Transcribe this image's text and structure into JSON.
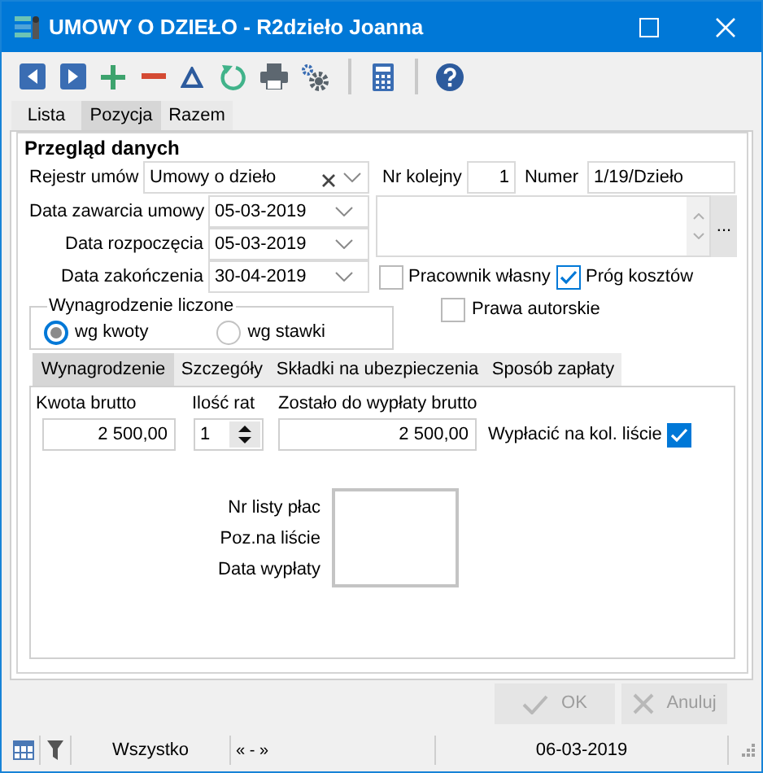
{
  "window": {
    "title": "UMOWY O DZIEŁO - R2dzieło Joanna"
  },
  "tabs": [
    {
      "label": "Lista",
      "selected": false
    },
    {
      "label": "Pozycja",
      "selected": true
    },
    {
      "label": "Razem",
      "selected": false
    }
  ],
  "overview": {
    "title": "Przegląd danych",
    "register": {
      "label": "Rejestr umów",
      "value": "Umowy o dzieło"
    },
    "sequence": {
      "label": "Nr kolejny",
      "value": "1"
    },
    "number": {
      "label": "Numer",
      "value": "1/19/Dzieło"
    },
    "dates": [
      {
        "label": "Data zawarcia umowy",
        "value": "05-03-2019"
      },
      {
        "label": "Data rozpoczęcia",
        "value": "05-03-2019"
      },
      {
        "label": "Data zakończenia",
        "value": "30-04-2019"
      }
    ],
    "notes_button": "...",
    "flags": [
      {
        "label": "Pracownik własny",
        "checked": false
      },
      {
        "label": "Próg kosztów",
        "checked": true
      },
      {
        "label": "Prawa autorskie",
        "checked": false
      }
    ],
    "pay_basis": {
      "title": "Wynagrodzenie liczone",
      "options": [
        {
          "label": "wg kwoty",
          "selected": true
        },
        {
          "label": "wg stawki",
          "selected": false
        }
      ]
    },
    "detail_tabs": [
      {
        "label": "Wynagrodzenie",
        "selected": true
      },
      {
        "label": "Szczegóły",
        "selected": false
      },
      {
        "label": "Składki na ubezpieczenia",
        "selected": false
      },
      {
        "label": "Sposób zapłaty",
        "selected": false
      }
    ],
    "gross": {
      "label": "Kwota brutto",
      "value": "2 500,00"
    },
    "installments": {
      "label": "Ilość rat",
      "value": "1"
    },
    "remaining": {
      "label": "Zostało do wypłaty brutto",
      "value": "2 500,00"
    },
    "pay_on_next_list": {
      "label": "Wypłacić na kol. liście",
      "checked": true
    },
    "payroll_labels": [
      "Nr listy płac",
      "Poz.na liście",
      "Data wypłaty"
    ]
  },
  "buttons": [
    {
      "label": "OK",
      "kind": "ok",
      "disabled": true
    },
    {
      "label": "Anuluj",
      "kind": "cancel",
      "disabled": true
    }
  ],
  "status_bar": {
    "filter": "Wszystko",
    "nav": "« - »",
    "date": "06-03-2019"
  }
}
